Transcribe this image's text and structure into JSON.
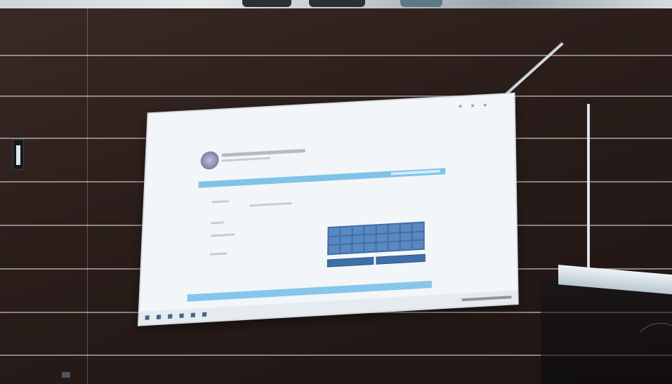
{
  "scene": {
    "description_colors": {
      "wall_dark": "#2b1e1b",
      "screen_bg": "#f3f6f8",
      "accent_blue": "#7fc3e8",
      "keypad_blue": "#3f6fa8"
    },
    "icons": [
      "emblem-icon",
      "taskbar-icons"
    ]
  }
}
